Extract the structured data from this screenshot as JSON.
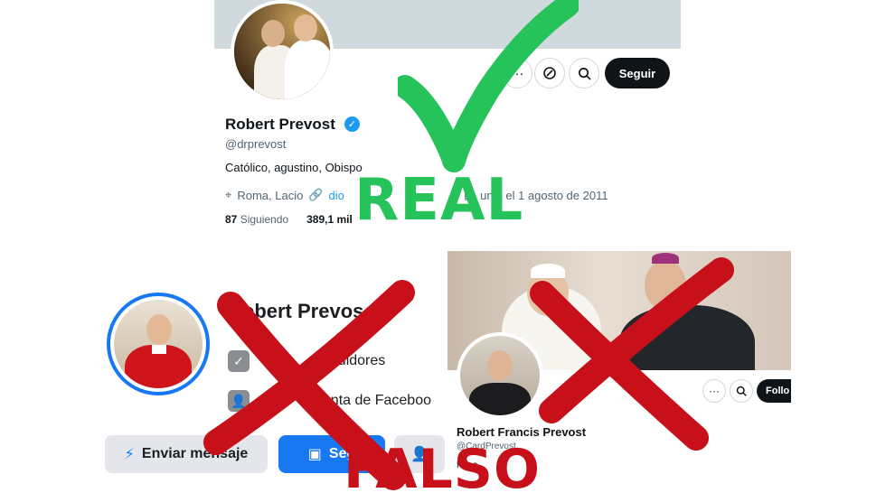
{
  "x_real": {
    "name": "Robert Prevost",
    "handle": "@drprevost",
    "bio": "Católico, agustino, Obispo",
    "location": "Roma, Lacio",
    "link": "dio",
    "joined": "unió el 1 agosto de 2011",
    "following_count": "87",
    "following_label": "Siguiendo",
    "followers_count": "389,1 mil",
    "follow_label": "Seguir",
    "more_label": "···"
  },
  "real_label": "REAL",
  "fb_fake": {
    "name": "Robert Prevos",
    "followers_text": "seguidores",
    "account_text": "cuenta de Faceboo",
    "message_label": "Enviar mensaje",
    "follow_label": "Seg"
  },
  "x_fake": {
    "name": "Robert Francis Prevost",
    "handle": "@CardPrevost",
    "bio": "Pope",
    "follow_label": "Follo",
    "more_label": "···"
  },
  "falso_label": "FALSO",
  "colors": {
    "real_green": "#26c35a",
    "falso_red": "#c8101b",
    "x_verified_blue": "#1d9bf0",
    "fb_blue": "#1877f2"
  }
}
